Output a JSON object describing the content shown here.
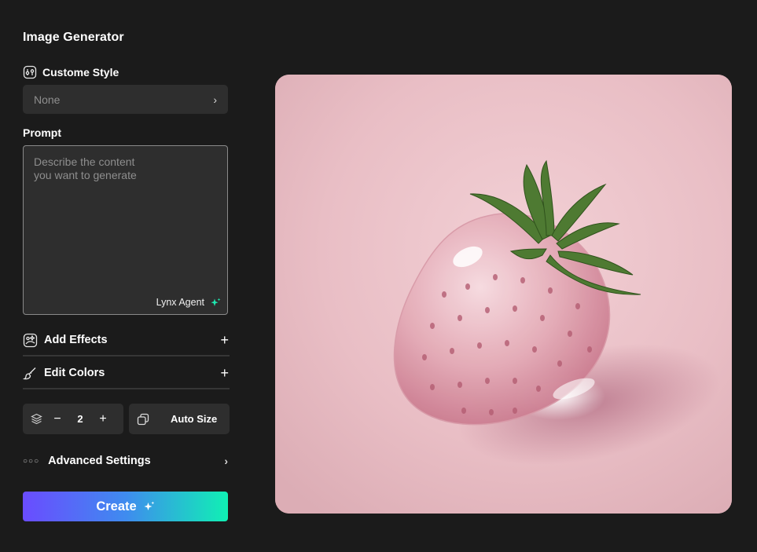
{
  "app": {
    "title": "Image Generator"
  },
  "custom_style": {
    "label": "Custome Style",
    "icon": "style-sliders-icon",
    "selected": "None"
  },
  "prompt": {
    "label": "Prompt",
    "placeholder": "Describe the content\nyou want to generate",
    "value": "",
    "agent_label": "Lynx Agent",
    "agent_icon": "sparkle-icon"
  },
  "effects": {
    "label": "Add Effects",
    "icon": "effects-icon"
  },
  "colors": {
    "label": "Edit Colors",
    "icon": "brush-icon"
  },
  "count": {
    "value": "2",
    "icon": "layers-icon"
  },
  "size": {
    "label": "Auto Size",
    "icon": "resize-icon"
  },
  "advanced": {
    "label": "Advanced Settings",
    "icon": "dots-icon"
  },
  "create": {
    "label": "Create",
    "icon": "sparkle-icon"
  },
  "preview": {
    "subject": "pink glass strawberry"
  },
  "theme": {
    "background": "#1b1b1b",
    "surface": "#2e2e2e",
    "gradient_start": "#6a4cff",
    "gradient_end": "#10f0b4",
    "accent": "#1ee8b0"
  }
}
